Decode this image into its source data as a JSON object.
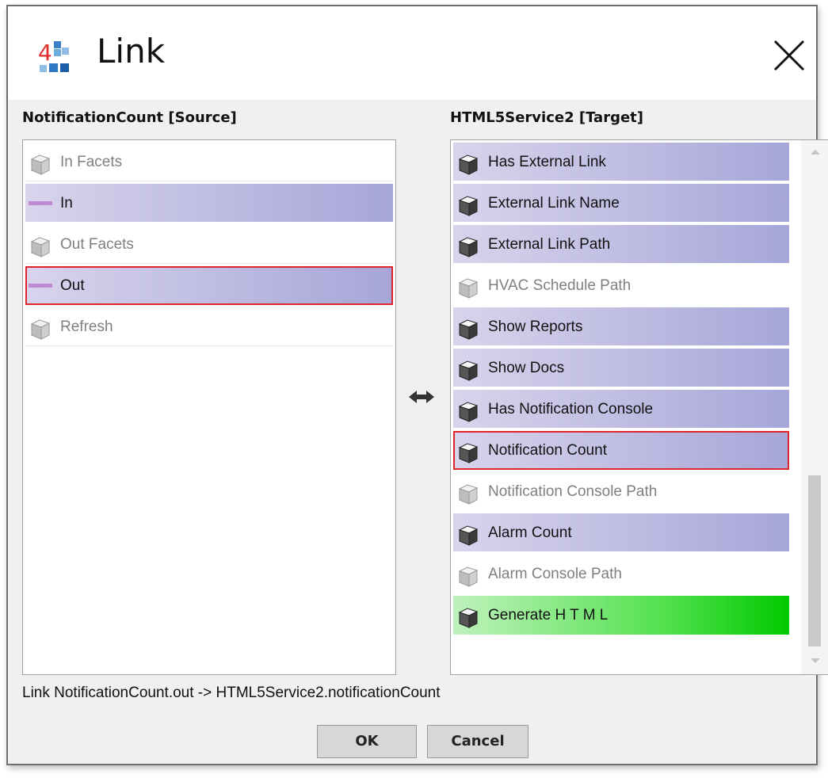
{
  "dialog": {
    "title": "Link",
    "logo_icon": "niagara-4-logo-icon",
    "close_icon": "close-icon"
  },
  "source": {
    "header": "NotificationCount [Source]",
    "items": [
      {
        "label": "In Facets",
        "icon": "slot-cube-icon",
        "state": "inactive"
      },
      {
        "label": "In",
        "icon": "property-dash-icon",
        "state": "active"
      },
      {
        "label": "Out Facets",
        "icon": "slot-cube-icon",
        "state": "inactive"
      },
      {
        "label": "Out",
        "icon": "property-dash-icon",
        "state": "active",
        "selected": true
      },
      {
        "label": "Refresh",
        "icon": "slot-cube-icon",
        "state": "inactive"
      }
    ]
  },
  "swap_icon": "bidirectional-arrow-icon",
  "target": {
    "header": "HTML5Service2 [Target]",
    "items": [
      {
        "label": "Has External Link",
        "icon": "slot-cube-icon",
        "state": "active"
      },
      {
        "label": "External Link Name",
        "icon": "slot-cube-icon",
        "state": "active"
      },
      {
        "label": "External Link Path",
        "icon": "slot-cube-icon",
        "state": "active"
      },
      {
        "label": "HVAC Schedule Path",
        "icon": "slot-cube-icon",
        "state": "inactive"
      },
      {
        "label": "Show Reports",
        "icon": "slot-cube-icon",
        "state": "active"
      },
      {
        "label": "Show Docs",
        "icon": "slot-cube-icon",
        "state": "active"
      },
      {
        "label": "Has Notification Console",
        "icon": "slot-cube-icon",
        "state": "active"
      },
      {
        "label": "Notification Count",
        "icon": "slot-cube-icon",
        "state": "active",
        "selected": true
      },
      {
        "label": "Notification Console Path",
        "icon": "slot-cube-icon",
        "state": "inactive"
      },
      {
        "label": "Alarm Count",
        "icon": "slot-cube-icon",
        "state": "active"
      },
      {
        "label": "Alarm Console Path",
        "icon": "slot-cube-icon",
        "state": "inactive"
      },
      {
        "label": "Generate H T M L",
        "icon": "slot-cube-icon",
        "state": "green"
      }
    ]
  },
  "link_text": "Link NotificationCount.out -> HTML5Service2.notificationCount",
  "buttons": {
    "ok": "OK",
    "cancel": "Cancel"
  },
  "colors": {
    "active_row_start": "#d8d4ec",
    "active_row_end": "#a6a6d8",
    "selected_outline": "#e0242c",
    "green_row_end": "#00c800",
    "property_dash": "#c08ad0"
  }
}
